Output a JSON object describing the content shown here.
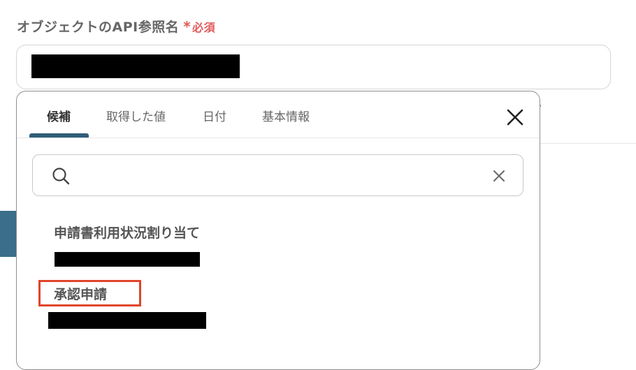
{
  "field": {
    "label": "オブジェクトのAPI参照名",
    "required_star": "*",
    "required_text": "必須"
  },
  "dropdown": {
    "tabs": [
      {
        "label": "候補"
      },
      {
        "label": "取得した値"
      },
      {
        "label": "日付"
      },
      {
        "label": "基本情報"
      }
    ],
    "active_tab": "候補",
    "search": {
      "value": "",
      "placeholder": ""
    },
    "options": [
      {
        "label": "申請書利用状況割り当て"
      },
      {
        "label": "承認申請",
        "highlighted": true
      }
    ]
  },
  "colors": {
    "accent": "#2f5e78",
    "required": "#e05a5a",
    "highlight": "#e0442a"
  },
  "icons": [
    "search-icon",
    "close-icon",
    "clear-icon"
  ]
}
